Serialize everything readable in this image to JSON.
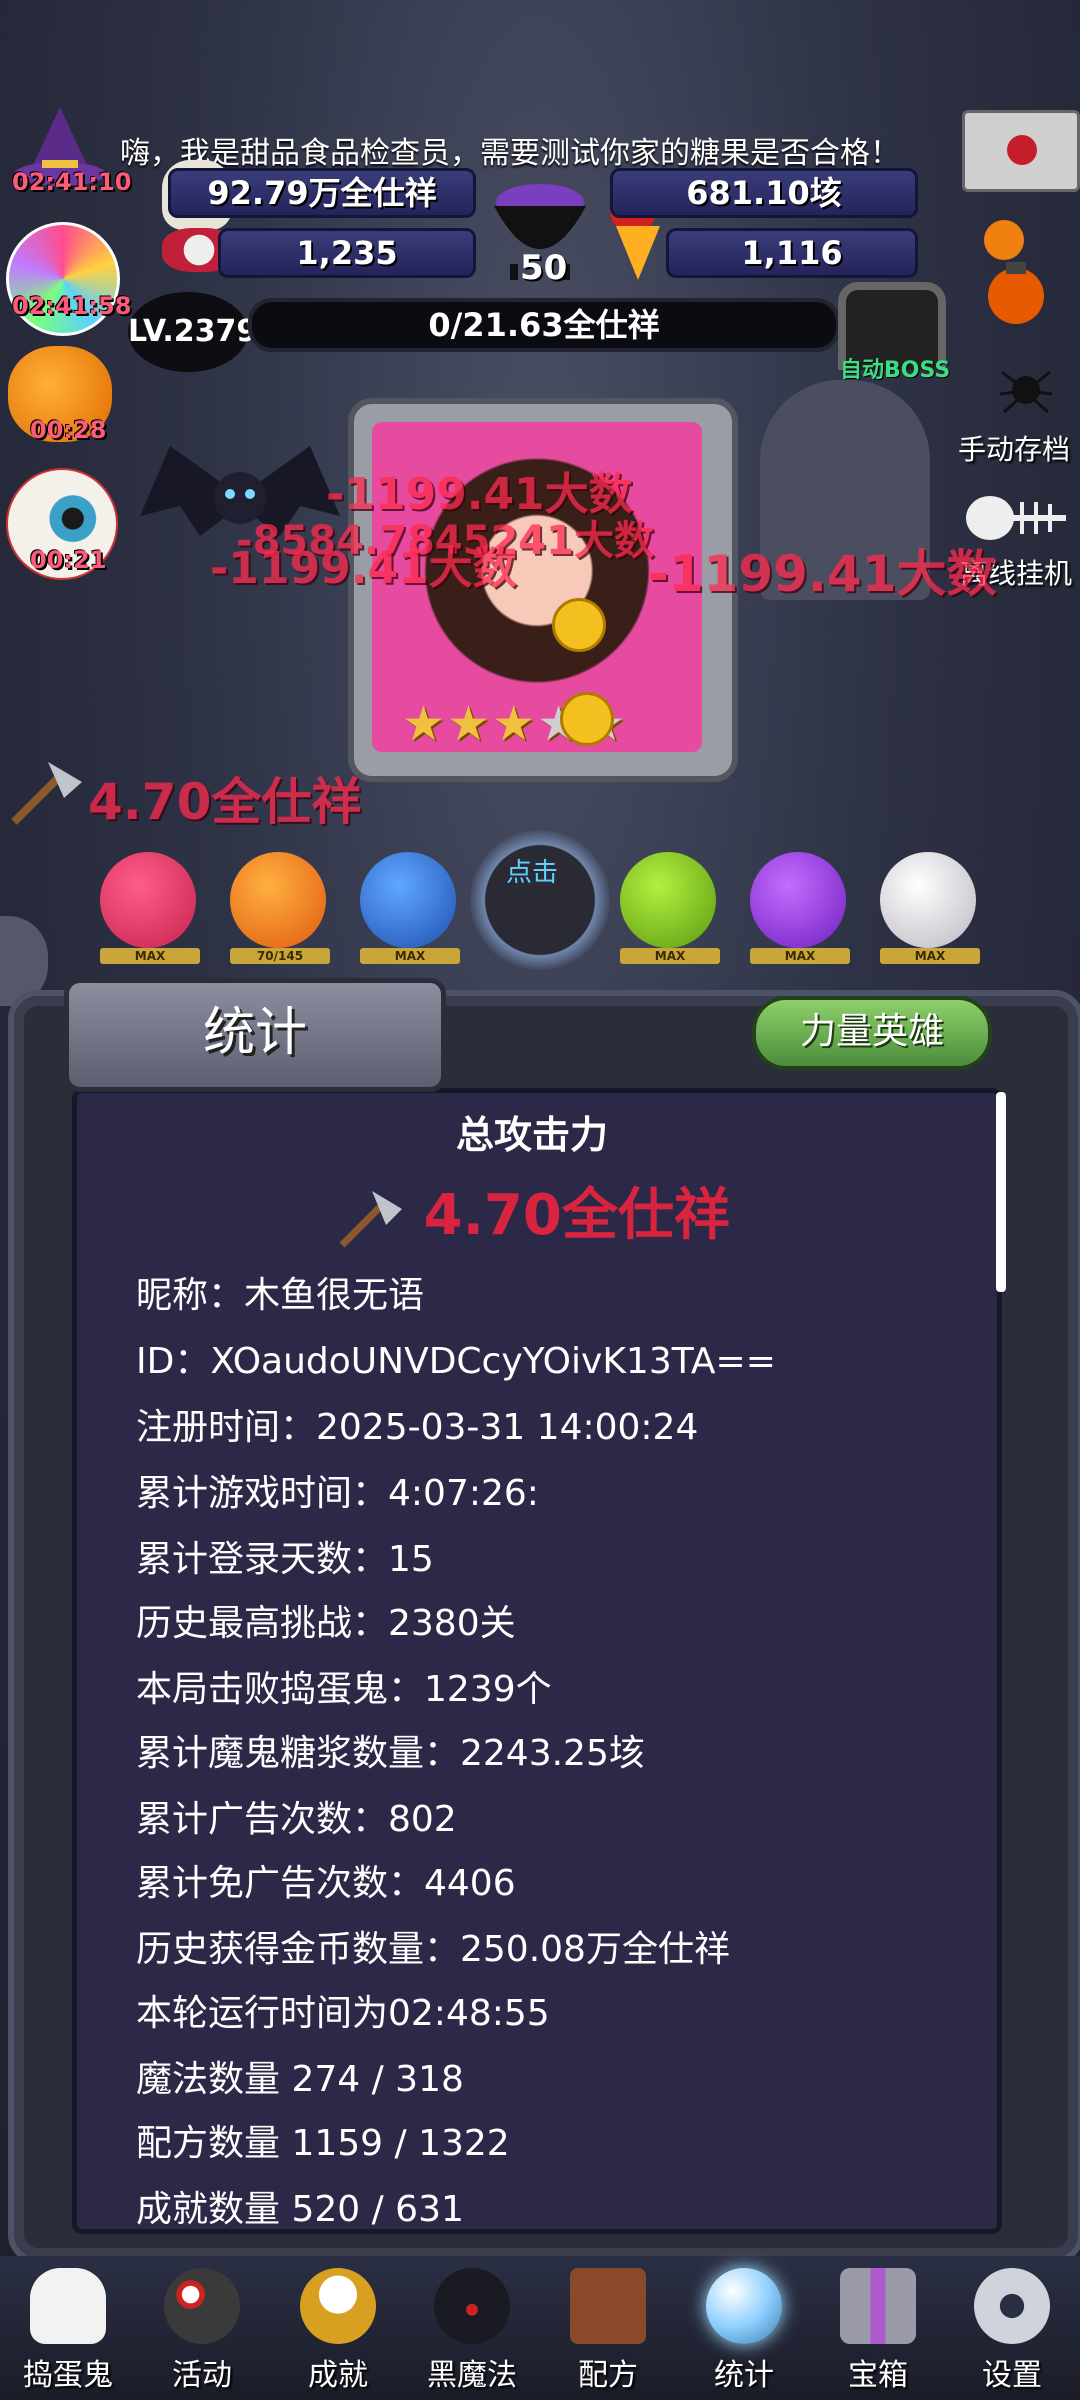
{
  "header": {
    "marquee": "嗨，我是甜品食品检查员，需要测试你家的糖果是否合格！",
    "timers": [
      "02:41:10",
      "02:41:58",
      "00:28",
      "00:21"
    ],
    "resources": {
      "candy": "92.79万全仕祥",
      "potion": "681.10垓",
      "skull": "1,235",
      "corn": "1,116",
      "cauldron_count": "50"
    },
    "level": "LV.2379",
    "progress_text": "0/21.63全仕祥",
    "boss_label": "自动BOSS",
    "manual_save": "手动存档",
    "offline": "离线挂机"
  },
  "battle": {
    "damage_numbers": [
      "-1199.41大数",
      "-8584.7845241大数",
      "-1199.41大数",
      "-1199.41大数"
    ],
    "axe_power": "4.70全仕祥",
    "click_label": "点击",
    "monster_caps": [
      "MAX",
      "70/145",
      "MAX",
      "MAX",
      "MAX",
      "MAX"
    ],
    "hero_stars": 3
  },
  "panel": {
    "tab_stats": "统计",
    "tab_hero": "力量英雄",
    "title": "总攻击力",
    "attack_value": "4.70全仕祥",
    "lines": [
      "昵称：木鱼很无语",
      "ID：XOaudoUNVDCcyYOivK13TA==",
      "注册时间：2025-03-31 14:00:24",
      "累计游戏时间：4:07:26:",
      "累计登录天数：15",
      "历史最高挑战：2380关",
      "本局击败捣蛋鬼：1239个",
      "累计魔鬼糖浆数量：2243.25垓",
      "累计广告次数：802",
      "累计免广告次数：4406",
      "历史获得金币数量：250.08万全仕祥",
      "本轮运行时间为02:48:55",
      "魔法数量 274 / 318",
      "配方数量 1159 / 1322",
      "成就数量 520 / 631"
    ]
  },
  "nav": [
    {
      "label": "捣蛋鬼",
      "icon": "ghost-icon"
    },
    {
      "label": "活动",
      "icon": "eyes-bowl-icon"
    },
    {
      "label": "成就",
      "icon": "skull-trophy-icon"
    },
    {
      "label": "黑魔法",
      "icon": "demon-icon"
    },
    {
      "label": "配方",
      "icon": "spellbook-icon"
    },
    {
      "label": "统计",
      "icon": "crystal-ball-icon"
    },
    {
      "label": "宝箱",
      "icon": "gift-box-icon"
    },
    {
      "label": "设置",
      "icon": "gear-icon"
    }
  ]
}
